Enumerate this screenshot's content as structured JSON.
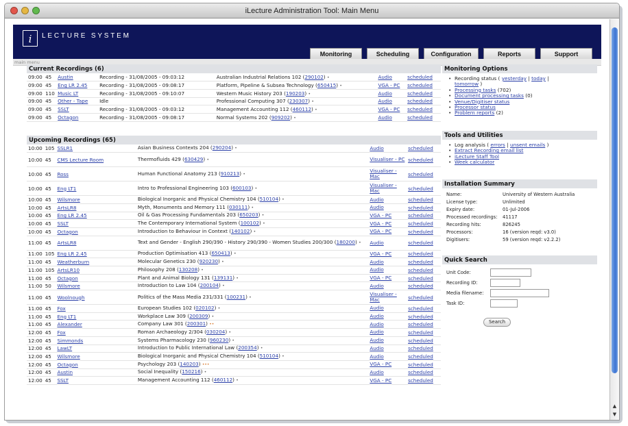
{
  "window": {
    "title": "iLecture Administration Tool: Main Menu"
  },
  "header": {
    "logo_letter": "i",
    "logo_text": "LECTURE SYSTEM",
    "tabs": [
      "Monitoring",
      "Scheduling",
      "Configuration",
      "Reports",
      "Support"
    ],
    "subnav": "main menu"
  },
  "current": {
    "title": "Current Recordings (6)",
    "rows": [
      {
        "time": "09:00",
        "dur": "45",
        "venue": "Austin",
        "status": "Recording - 31/08/2005 - 09:03:12",
        "course": "Australian Industrial Relations 102 (",
        "code": "290102",
        "media": "Audio",
        "sched": "scheduled"
      },
      {
        "time": "09:00",
        "dur": "45",
        "venue": "Eng LR 2.45",
        "status": "Recording - 31/08/2005 - 09:08:17",
        "course": "Platform, Pipeline & Subsea Technology (",
        "code": "650415",
        "media": "VGA - PC",
        "sched": "scheduled"
      },
      {
        "time": "09:00",
        "dur": "110",
        "venue": "Music LT",
        "status": "Recording - 31/08/2005 - 09:10:07",
        "course": "Western Music History 203 (",
        "code": "190203",
        "media": "Audio",
        "sched": "scheduled"
      },
      {
        "time": "09:00",
        "dur": "45",
        "venue": "Other - Tape",
        "status": "Idle",
        "course": "Professional Computing 307 (",
        "code": "230307",
        "media": "Audio",
        "sched": "scheduled"
      },
      {
        "time": "09:00",
        "dur": "45",
        "venue": "SSLT",
        "status": "Recording - 31/08/2005 - 09:03:12",
        "course": "Management Accounting 112 (",
        "code": "460112",
        "media": "VGA - PC",
        "sched": "scheduled"
      },
      {
        "time": "09:00",
        "dur": "45",
        "venue": "Octagon",
        "status": "Recording - 31/08/2005 - 09:08:17",
        "course": "Normal Systems 202 (",
        "code": "909202",
        "media": "Audio",
        "sched": "scheduled"
      }
    ]
  },
  "upcoming": {
    "title": "Upcoming Recordings (65)",
    "rows": [
      {
        "time": "10:00",
        "dur": "105",
        "venue": "SSLR1",
        "course": "Asian Business Contexts 204 (",
        "code": "290204",
        "tail": ")",
        "media": "Audio",
        "sched": "scheduled",
        "tall": false,
        "mark": "•"
      },
      {
        "time": "10:00",
        "dur": "45",
        "venue": "CMS Lecture Room",
        "course": "Thermofluids 429 (",
        "code": "630429",
        "tail": ")",
        "media": "Visualiser - PC",
        "sched": "scheduled",
        "tall": true,
        "mark": "•"
      },
      {
        "time": "10:00",
        "dur": "45",
        "venue": "Ross",
        "course": "Human Functional Anatomy 213 (",
        "code": "910213",
        "tail": ")",
        "media": "Visualiser - Mac",
        "sched": "scheduled",
        "tall": true,
        "mark": "•"
      },
      {
        "time": "10:00",
        "dur": "45",
        "venue": "Eng LT1",
        "course": "Intro to Professional Engineering 103 (",
        "code": "600103",
        "tail": ")",
        "media": "Visualiser - Mac",
        "sched": "scheduled",
        "tall": true,
        "mark": "•"
      },
      {
        "time": "10:00",
        "dur": "45",
        "venue": "Wilsmore",
        "course": "Biological Inorganic and Physical Chemistry 104 (",
        "code": "510104",
        "tail": ")",
        "media": "Audio",
        "sched": "scheduled",
        "tall": false,
        "mark": "•"
      },
      {
        "time": "10:00",
        "dur": "45",
        "venue": "ArtsLR8",
        "course": "Myth, Monuments and Memory 111 (",
        "code": "030111",
        "tail": ")",
        "media": "Audio",
        "sched": "scheduled",
        "tall": false,
        "mark": "•"
      },
      {
        "time": "10:00",
        "dur": "45",
        "venue": "Eng LR 2.45",
        "course": "Oil & Gas Processing Fundamentals 203 (",
        "code": "650203",
        "tail": ")",
        "media": "VGA - PC",
        "sched": "scheduled",
        "tall": false,
        "mark": "•"
      },
      {
        "time": "10:00",
        "dur": "45",
        "venue": "SSLT",
        "course": "The Contemporary International System (",
        "code": "100102",
        "tail": ")",
        "media": "VGA - PC",
        "sched": "scheduled",
        "tall": false,
        "mark": "•"
      },
      {
        "time": "10:00",
        "dur": "45",
        "venue": "Octagon",
        "course": "Introduction to Behaviour in Context (",
        "code": "140102",
        "tail": ")",
        "media": "VGA - PC",
        "sched": "scheduled",
        "tall": false,
        "mark": "•"
      },
      {
        "time": "11:00",
        "dur": "45",
        "venue": "ArtsLR8",
        "course": "Text and Gender - English 290/390 - History 290/390 - Women Studies 200/300 (",
        "code": "180200",
        "tail": ")",
        "media": "Audio",
        "sched": "scheduled",
        "tall": true,
        "mark": "•"
      },
      {
        "time": "11:00",
        "dur": "105",
        "venue": "Eng LR 2.45",
        "course": "Production Optimisation 413 (",
        "code": "650413",
        "tail": ")",
        "media": "VGA - PC",
        "sched": "scheduled",
        "tall": false,
        "mark": "•"
      },
      {
        "time": "11:00",
        "dur": "45",
        "venue": "Weatherburn",
        "course": "Molecular Genetics 230 (",
        "code": "920230",
        "tail": ")",
        "media": "Audio",
        "sched": "scheduled",
        "tall": false,
        "mark": "•"
      },
      {
        "time": "11:00",
        "dur": "105",
        "venue": "ArtsLR10",
        "course": "Philosophy 208 (",
        "code": "130208",
        "tail": ")",
        "media": "Audio",
        "sched": "scheduled",
        "tall": false,
        "mark": "•"
      },
      {
        "time": "11:00",
        "dur": "45",
        "venue": "Octagon",
        "course": "Plant and Animal Biology 131 (",
        "code": "139131",
        "tail": ")",
        "media": "VGA - PC",
        "sched": "scheduled",
        "tall": false,
        "mark": "•"
      },
      {
        "time": "11:00",
        "dur": "50",
        "venue": "Wilsmore",
        "course": "Introduction to Law 104 (",
        "code": "200104",
        "tail": ")",
        "media": "Audio",
        "sched": "scheduled",
        "tall": false,
        "mark": "•"
      },
      {
        "time": "11:00",
        "dur": "45",
        "venue": "Woolnough",
        "course": "Politics of the Mass Media 231/331 (",
        "code": "100231",
        "tail": ")",
        "media": "Visualiser - Mac",
        "sched": "scheduled",
        "tall": true,
        "mark": "•"
      },
      {
        "time": "11:00",
        "dur": "45",
        "venue": "Fox",
        "course": "European Studies 102 (",
        "code": "020102",
        "tail": ")",
        "media": "Audio",
        "sched": "scheduled",
        "tall": false,
        "mark": "•"
      },
      {
        "time": "11:00",
        "dur": "45",
        "venue": "Eng LT1",
        "course": "Workplace Law 309 (",
        "code": "200309",
        "tail": ")",
        "media": "Audio",
        "sched": "scheduled",
        "tall": false,
        "mark": "•"
      },
      {
        "time": "11:00",
        "dur": "45",
        "venue": "Alexander",
        "course": "Company Law 301 (",
        "code": "200301",
        "tail": ")",
        "media": "Audio",
        "sched": "scheduled",
        "tall": false,
        "mark": "••"
      },
      {
        "time": "12:00",
        "dur": "45",
        "venue": "Fox",
        "course": "Roman Archaeology 2/304 (",
        "code": "030204",
        "tail": ")",
        "media": "Audio",
        "sched": "scheduled",
        "tall": false,
        "mark": "•"
      },
      {
        "time": "12:00",
        "dur": "45",
        "venue": "Simmonds",
        "course": "Systems Pharmacology 230 (",
        "code": "960230",
        "tail": ")",
        "media": "Audio",
        "sched": "scheduled",
        "tall": false,
        "mark": "•"
      },
      {
        "time": "12:00",
        "dur": "45",
        "venue": "LawLT",
        "course": "Introduction to Public International Law (",
        "code": "200354",
        "tail": ")",
        "media": "Audio",
        "sched": "scheduled",
        "tall": false,
        "mark": "•"
      },
      {
        "time": "12:00",
        "dur": "45",
        "venue": "Wilsmore",
        "course": "Biological Inorganic and Physical Chemistry 104 (",
        "code": "510104",
        "tail": ")",
        "media": "Audio",
        "sched": "scheduled",
        "tall": false,
        "mark": "•"
      },
      {
        "time": "12:00",
        "dur": "45",
        "venue": "Octagon",
        "course": "Psychology 203 (",
        "code": "140203",
        "tail": ")",
        "media": "VGA - PC",
        "sched": "scheduled",
        "tall": false,
        "mark": "•••"
      },
      {
        "time": "12:00",
        "dur": "45",
        "venue": "Austin",
        "course": "Social Inequality (",
        "code": "150216",
        "tail": ")",
        "media": "Audio",
        "sched": "scheduled",
        "tall": false,
        "mark": "•"
      },
      {
        "time": "12:00",
        "dur": "45",
        "venue": "SSLT",
        "course": "Management Accounting 112 (",
        "code": "460112",
        "tail": ")",
        "media": "VGA - PC",
        "sched": "scheduled",
        "tall": false,
        "mark": "•"
      }
    ]
  },
  "monitoring_options": {
    "title": "Monitoring Options",
    "recording_status_prefix": "Recording status ( ",
    "yesterday": "yesterday",
    "today": "today",
    "tomorrow": "tomorrow",
    "recording_status_suffix": " )",
    "processing_tasks": "Processing tasks",
    "processing_count": "(702)",
    "document_tasks": "Document processing tasks",
    "document_count": "(0)",
    "venue_status": "Venue/Digitiser status",
    "processor_status": "Processor status",
    "problem_reports": "Problem reports",
    "problem_count": "(2)"
  },
  "tools": {
    "title": "Tools and Utilities",
    "log_prefix": "Log analysis ( ",
    "errors": "errors",
    "unsent": "unsent emails",
    "log_suffix": " )",
    "extract": "Extract Recording email list",
    "staff_tool": "iLecture Staff Tool",
    "week_calc": "Week calculator"
  },
  "install": {
    "title": "Installation Summary",
    "rows": [
      {
        "k": "Name:",
        "v": "University of Western Australia"
      },
      {
        "k": "License type:",
        "v": "Unlimited"
      },
      {
        "k": "Expiry date:",
        "v": "01-Jul-2006"
      },
      {
        "k": "Processed recordings:",
        "v": "41117"
      },
      {
        "k": "Recording hits:",
        "v": "826245"
      },
      {
        "k": "Processors:",
        "v": "16  (version reqd: v3.0)"
      },
      {
        "k": "Digitisers:",
        "v": "59  (version reqd: v2.2.2)"
      }
    ]
  },
  "quick_search": {
    "title": "Quick Search",
    "unit_code": "Unit Code:",
    "recording_id": "Recording ID:",
    "media_filename": "Media filename:",
    "task_id": "Task ID:",
    "button": "Search"
  }
}
